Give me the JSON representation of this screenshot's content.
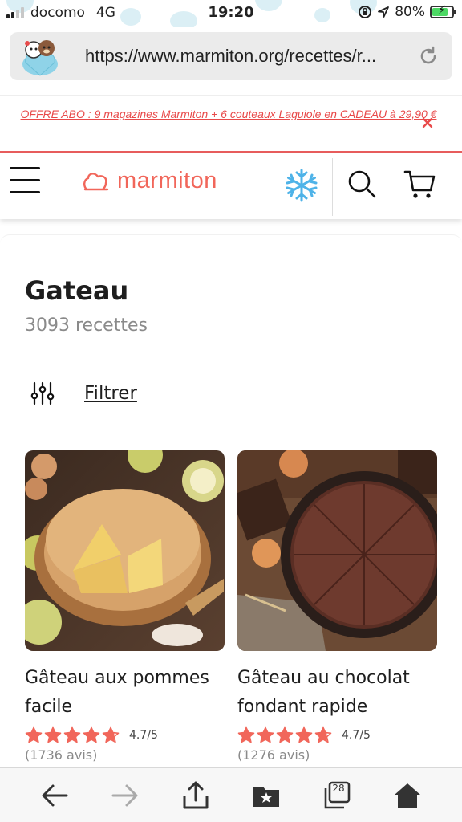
{
  "status_bar": {
    "carrier": "docomo",
    "network": "4G",
    "time": "19:20",
    "battery": "80%"
  },
  "browser": {
    "url": "https://www.marmiton.org/recettes/r..."
  },
  "promo": {
    "text": "OFFRE ABO : 9 magazines Marmiton + 6 couteaux Laguiole en CADEAU à 29,90 €"
  },
  "header": {
    "logo_text": "marmiton"
  },
  "main": {
    "title": "Gateau",
    "count": "3093 recettes",
    "filter_label": "Filtrer"
  },
  "recipes": [
    {
      "title": "Gâteau aux pommes facile",
      "rating": "4.7/5",
      "rating_value": 4.7,
      "reviews": "(1736 avis)"
    },
    {
      "title": "Gâteau au chocolat fondant rapide",
      "rating": "4.7/5",
      "rating_value": 4.7,
      "reviews": "(1276 avis)"
    }
  ],
  "toolbar": {
    "tabs_count": "28"
  },
  "colors": {
    "brand": "#f1665a",
    "promo": "#e84a4a",
    "star": "#f1665a",
    "snowflake": "#4fb3e8"
  },
  "icons": [
    "signal-icon",
    "rotation-lock-icon",
    "location-icon",
    "battery-icon",
    "avatar-icon",
    "reload-icon",
    "close-icon",
    "menu-icon",
    "snowflake-icon",
    "search-icon",
    "cart-icon",
    "filter-icon",
    "star-icon",
    "back-icon",
    "forward-icon",
    "share-icon",
    "bookmarks-icon",
    "tabs-icon",
    "home-icon"
  ]
}
